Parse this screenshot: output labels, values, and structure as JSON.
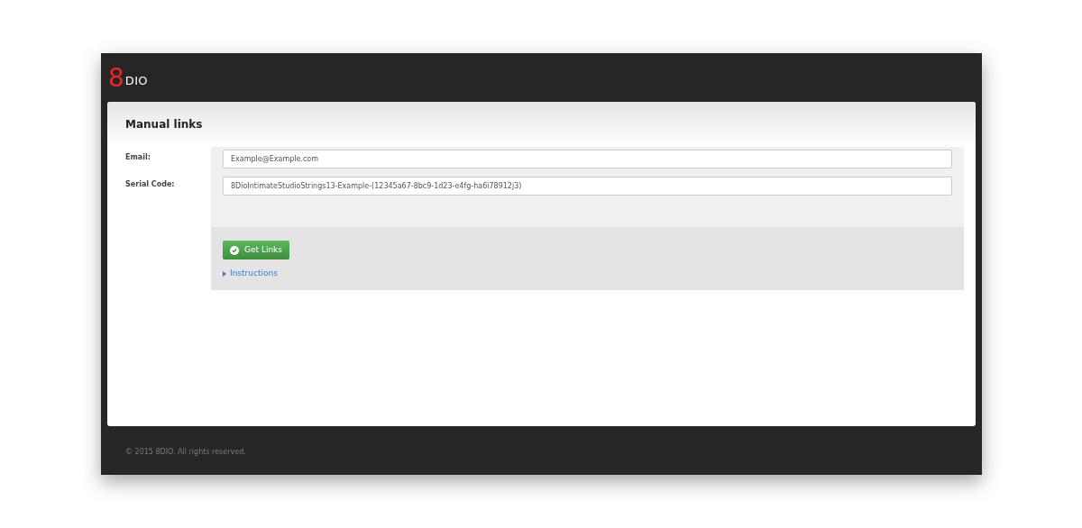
{
  "logo": {
    "mark": "8",
    "text": "DIO"
  },
  "panel": {
    "title": "Manual links"
  },
  "fields": [
    {
      "label": "Email:",
      "value": "Example@Example.com"
    },
    {
      "label": "Serial Code:",
      "value": "8DioIntimateStudioStrings13-Example-(12345a67-8bc9-1d23-e4fg-ha6i78912j3)"
    }
  ],
  "submit": {
    "label": "Get Links"
  },
  "instructions": {
    "label": "Instructions",
    "expanded": false
  },
  "footer": {
    "text": "© 2015 8DIO. All rights reserved."
  }
}
